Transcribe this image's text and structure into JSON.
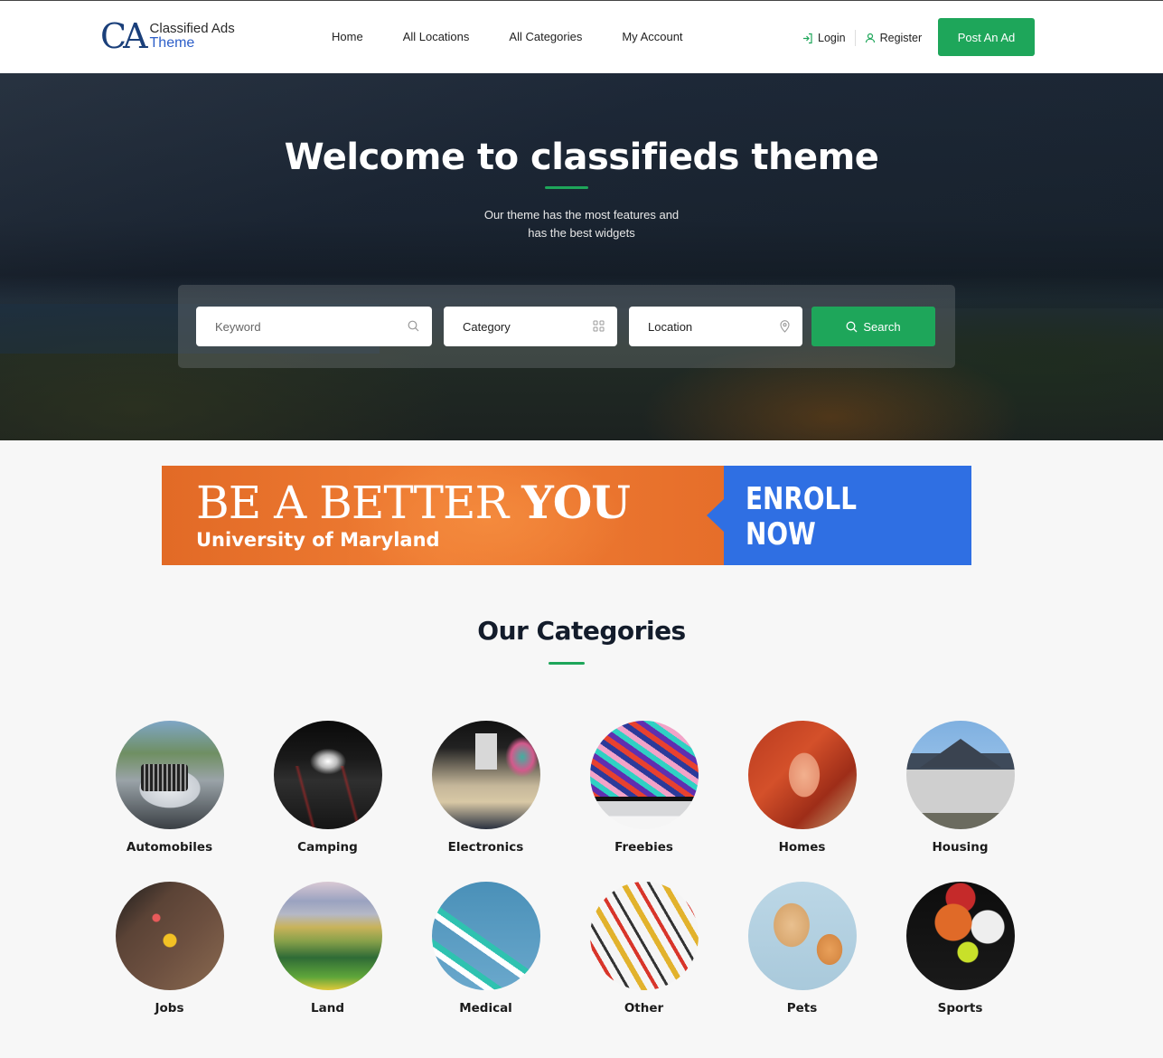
{
  "header": {
    "logo": {
      "mark": "CA",
      "line1": "Classified Ads",
      "line2": "Theme"
    },
    "nav": [
      {
        "label": "Home"
      },
      {
        "label": "All Locations"
      },
      {
        "label": "All Categories"
      },
      {
        "label": "My Account"
      }
    ],
    "auth": {
      "login": "Login",
      "register": "Register"
    },
    "post_ad_label": "Post An Ad"
  },
  "hero": {
    "title": "Welcome to classifieds theme",
    "subtitle_line1": "Our theme has the most features and",
    "subtitle_line2": "has the best widgets",
    "search": {
      "keyword_placeholder": "Keyword",
      "category_value": "Category",
      "location_value": "Location",
      "button_label": "Search"
    }
  },
  "banner": {
    "headline_thin": "BE A BETTER",
    "headline_bold": "YOU",
    "subline": "University of Maryland",
    "cta_line1": "ENROLL",
    "cta_line2": "NOW"
  },
  "categories": {
    "title": "Our Categories",
    "items": [
      {
        "label": "Automobiles"
      },
      {
        "label": "Camping"
      },
      {
        "label": "Electronics"
      },
      {
        "label": "Freebies"
      },
      {
        "label": "Homes"
      },
      {
        "label": "Housing"
      },
      {
        "label": "Jobs"
      },
      {
        "label": "Land"
      },
      {
        "label": "Medical"
      },
      {
        "label": "Other"
      },
      {
        "label": "Pets"
      },
      {
        "label": "Sports"
      }
    ]
  },
  "colors": {
    "accent_green": "#1ea65a",
    "logo_blue": "#1a3f7a",
    "banner_orange": "#ef7d34",
    "banner_blue": "#2f6fe3"
  }
}
